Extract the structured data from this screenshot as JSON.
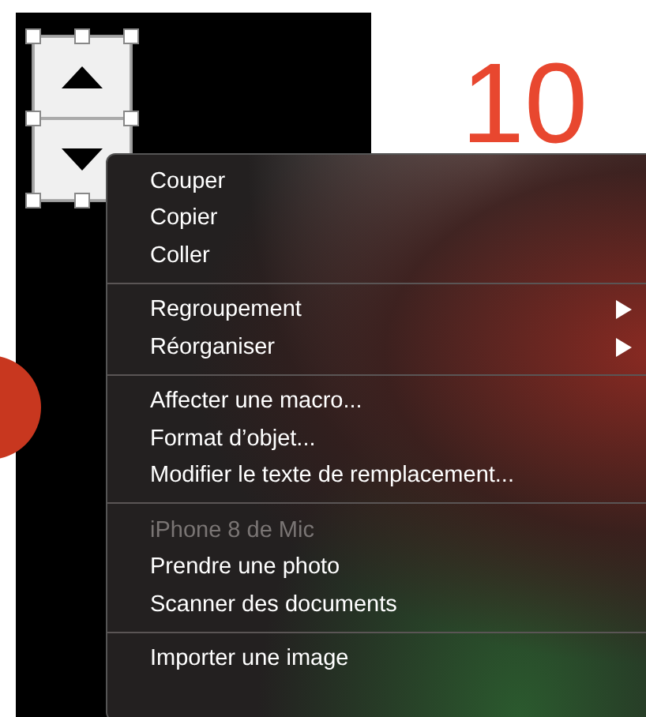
{
  "slide": {
    "number": "10"
  },
  "menu": {
    "groups": [
      [
        {
          "label": "Couper",
          "disabled": false,
          "submenu": false
        },
        {
          "label": "Copier",
          "disabled": false,
          "submenu": false
        },
        {
          "label": "Coller",
          "disabled": false,
          "submenu": false
        }
      ],
      [
        {
          "label": "Regroupement",
          "disabled": false,
          "submenu": true
        },
        {
          "label": "Réorganiser",
          "disabled": false,
          "submenu": true
        }
      ],
      [
        {
          "label": "Affecter une macro...",
          "disabled": false,
          "submenu": false
        },
        {
          "label": "Format d’objet...",
          "disabled": false,
          "submenu": false
        },
        {
          "label": "Modifier le texte de remplacement...",
          "disabled": false,
          "submenu": false
        }
      ],
      [
        {
          "label": "iPhone 8 de Mic",
          "disabled": true,
          "submenu": false
        },
        {
          "label": "Prendre une photo",
          "disabled": false,
          "submenu": false
        },
        {
          "label": "Scanner des documents",
          "disabled": false,
          "submenu": false
        }
      ],
      [
        {
          "label": "Importer une image",
          "disabled": false,
          "submenu": false
        }
      ]
    ]
  }
}
